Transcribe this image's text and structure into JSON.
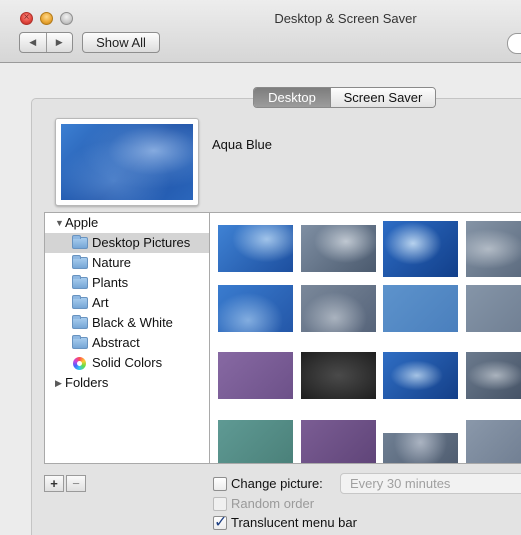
{
  "window": {
    "title": "Desktop & Screen Saver",
    "show_all_label": "Show All",
    "back_glyph": "◀",
    "forward_glyph": "▶"
  },
  "tabs": [
    {
      "label": "Desktop",
      "selected": true
    },
    {
      "label": "Screen Saver",
      "selected": false
    }
  ],
  "preview": {
    "picture_name": "Aqua Blue"
  },
  "source_list": {
    "group_label": "Apple",
    "items": [
      {
        "label": "Desktop Pictures",
        "icon": "folder-icon",
        "selected": true
      },
      {
        "label": "Nature",
        "icon": "folder-icon"
      },
      {
        "label": "Plants",
        "icon": "folder-icon"
      },
      {
        "label": "Art",
        "icon": "folder-icon"
      },
      {
        "label": "Black & White",
        "icon": "folder-icon"
      },
      {
        "label": "Abstract",
        "icon": "folder-icon"
      },
      {
        "label": "Solid Colors",
        "icon": "color-wheel-icon"
      }
    ],
    "folders_label": "Folders"
  },
  "thumbnails": [
    "aqua-blue",
    "aqua-graphite",
    "blue-flare",
    "graphite-flare",
    "blue-swirl",
    "graphite-swirl",
    "solid-blue",
    "solid-graphite",
    "purple",
    "dark-texture",
    "blue-burst",
    "graphite-burst",
    "teal",
    "violet",
    "graphite-wave",
    "gray"
  ],
  "controls": {
    "add_label": "+",
    "remove_label": "−",
    "change_picture_label": "Change picture:",
    "change_picture_checked": false,
    "interval_value": "Every 30 minutes",
    "random_order_label": "Random order",
    "random_order_enabled": false,
    "translucent_label": "Translucent menu bar",
    "translucent_checked": true
  },
  "colors": {
    "selection_gray": "#d4d4d4",
    "accent_blue": "#1e3f82"
  }
}
